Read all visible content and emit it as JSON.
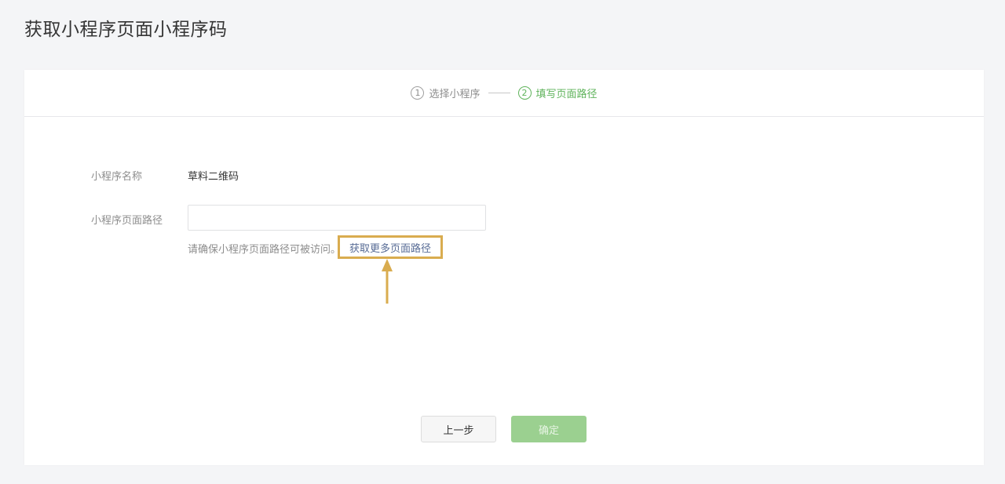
{
  "page": {
    "title": "获取小程序页面小程序码"
  },
  "steps": [
    {
      "num": "1",
      "label": "选择小程序",
      "active": false
    },
    {
      "num": "2",
      "label": "填写页面路径",
      "active": true
    }
  ],
  "form": {
    "name_label": "小程序名称",
    "name_value": "草料二维码",
    "path_label": "小程序页面路径",
    "path_value": "",
    "path_placeholder": "",
    "tip_text": "请确保小程序页面路径可被访问。",
    "more_link": "获取更多页面路径"
  },
  "buttons": {
    "prev_label": "上一步",
    "confirm_label": "确定"
  },
  "colors": {
    "accent_green": "#5fb35b",
    "confirm_disabled": "#9bd090",
    "link": "#576b95",
    "highlight": "#d9ac4f"
  }
}
